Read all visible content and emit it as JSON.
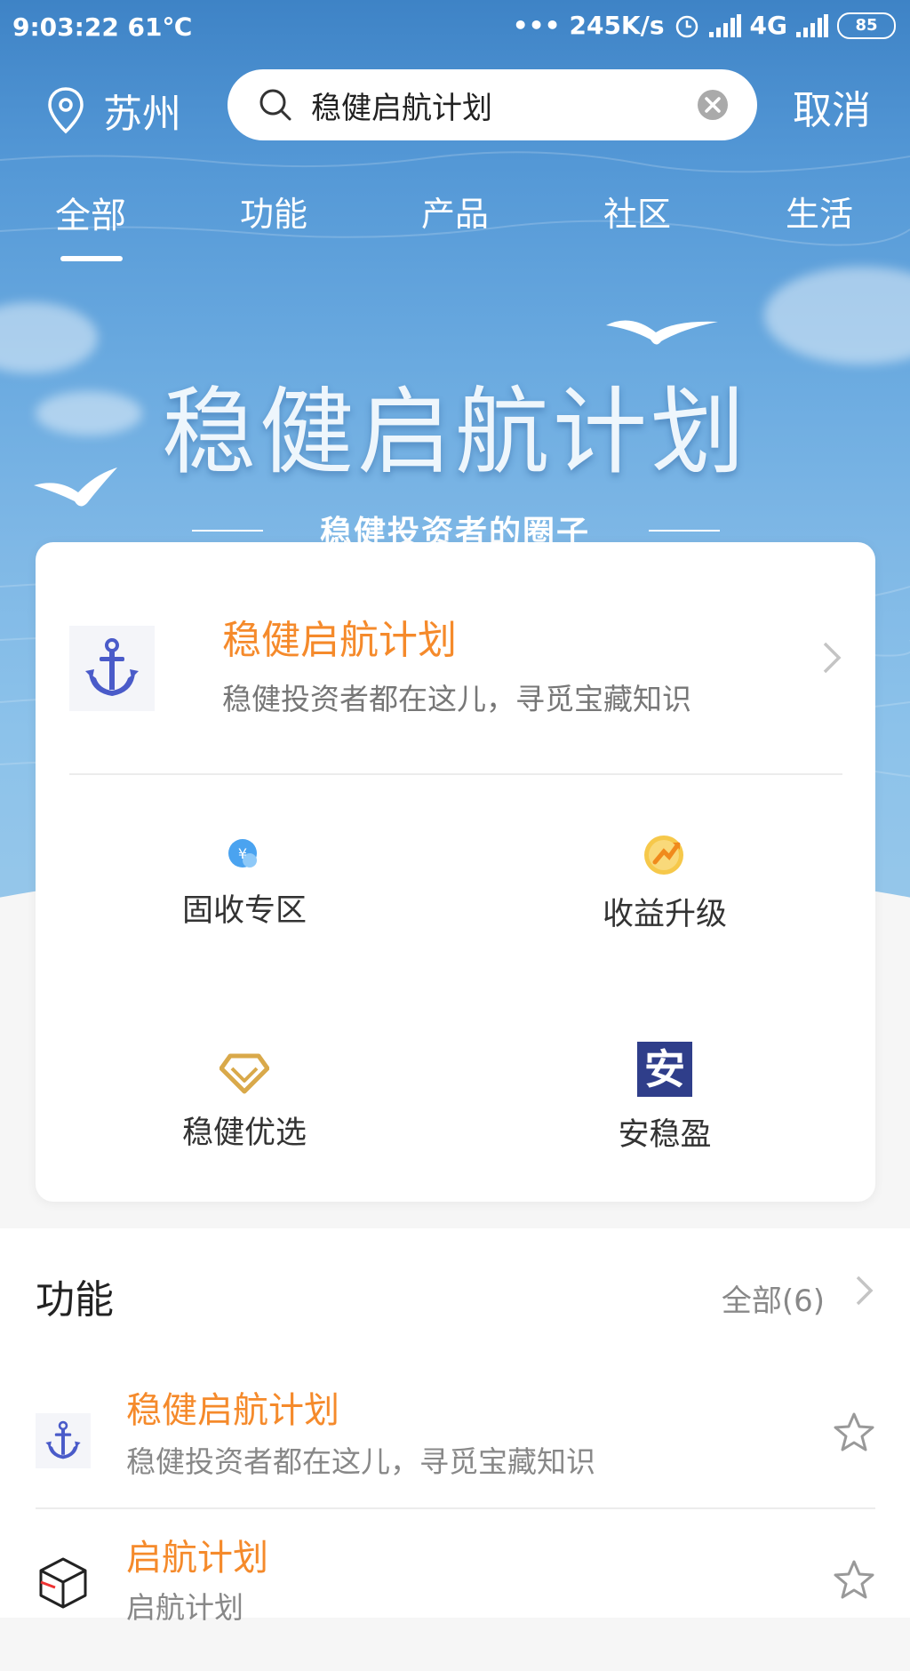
{
  "status_bar": {
    "time_temp": "9:03:22 61℃",
    "network_speed": "245K/s",
    "network_type": "4G",
    "battery": "85"
  },
  "header": {
    "city": "苏州",
    "search_value": "稳健启航计划",
    "cancel_label": "取消"
  },
  "tabs": [
    {
      "label": "全部",
      "active": true
    },
    {
      "label": "功能",
      "active": false
    },
    {
      "label": "产品",
      "active": false
    },
    {
      "label": "社区",
      "active": false
    },
    {
      "label": "生活",
      "active": false
    }
  ],
  "banner": {
    "title": "稳健启航计划",
    "subtitle": "稳健投资者的圈子"
  },
  "feature_card": {
    "title": "稳健启航计划",
    "description": "稳健投资者都在这儿，寻觅宝藏知识",
    "grid": [
      {
        "label": "固收专区",
        "icon": "yuan-coin-icon"
      },
      {
        "label": "收益升级",
        "icon": "growth-coin-icon"
      },
      {
        "label": "稳健优选",
        "icon": "diamond-icon"
      },
      {
        "label": "安稳盈",
        "icon": "an-logo-icon",
        "logo_text": "安"
      }
    ]
  },
  "function_section": {
    "title": "功能",
    "all_label": "全部(6)",
    "items": [
      {
        "title": "稳健启航计划",
        "description": "稳健投资者都在这儿，寻觅宝藏知识",
        "icon": "anchor-icon"
      },
      {
        "title": "启航计划",
        "description": "启航计划",
        "icon": "cube-icon"
      }
    ]
  },
  "colors": {
    "accent_orange": "#f58a2b",
    "sky_blue": "#5498d6",
    "navy_logo": "#2f3e8a",
    "anchor_blue": "#4a5bc9"
  }
}
